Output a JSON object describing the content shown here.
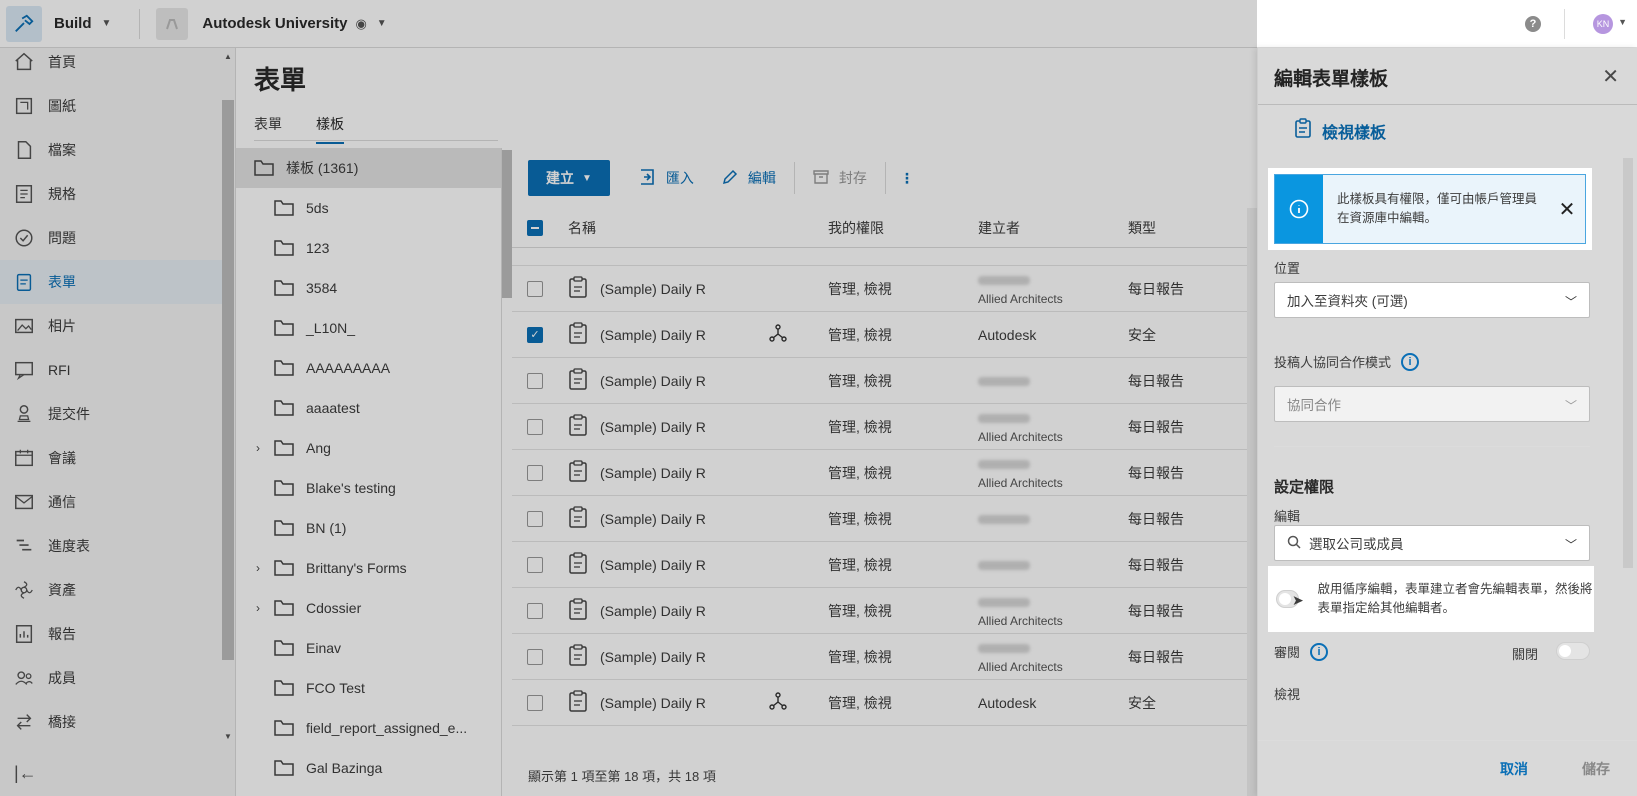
{
  "topbar": {
    "app_name": "Build",
    "project_name": "Autodesk University",
    "help_label": "?",
    "user_initials": "KN"
  },
  "sidebar": {
    "items": [
      {
        "label": "首頁",
        "icon": "home-icon"
      },
      {
        "label": "圖紙",
        "icon": "sheets-icon"
      },
      {
        "label": "檔案",
        "icon": "files-icon"
      },
      {
        "label": "規格",
        "icon": "specs-icon"
      },
      {
        "label": "問題",
        "icon": "issues-icon"
      },
      {
        "label": "表單",
        "icon": "forms-icon",
        "active": true
      },
      {
        "label": "相片",
        "icon": "photos-icon"
      },
      {
        "label": "RFI",
        "icon": "rfi-icon"
      },
      {
        "label": "提交件",
        "icon": "submittals-icon"
      },
      {
        "label": "會議",
        "icon": "meetings-icon"
      },
      {
        "label": "通信",
        "icon": "mail-icon"
      },
      {
        "label": "進度表",
        "icon": "schedule-icon"
      },
      {
        "label": "資產",
        "icon": "assets-icon"
      },
      {
        "label": "報告",
        "icon": "reports-icon"
      },
      {
        "label": "成員",
        "icon": "members-icon"
      },
      {
        "label": "橋接",
        "icon": "bridge-icon"
      }
    ]
  },
  "main": {
    "title": "表單",
    "tabs": [
      {
        "label": "表單"
      },
      {
        "label": "樣板",
        "active": true
      }
    ]
  },
  "folders": {
    "root": "樣板 (1361)",
    "items": [
      {
        "label": "5ds",
        "expandable": false
      },
      {
        "label": "123",
        "expandable": false
      },
      {
        "label": "3584",
        "expandable": false
      },
      {
        "label": "_L10N_",
        "expandable": false
      },
      {
        "label": "AAAAAAAAA",
        "expandable": false
      },
      {
        "label": "aaaatest",
        "expandable": false
      },
      {
        "label": "Ang",
        "expandable": true
      },
      {
        "label": "Blake's testing",
        "expandable": false
      },
      {
        "label": "BN (1)",
        "expandable": false
      },
      {
        "label": "Brittany's Forms",
        "expandable": true
      },
      {
        "label": "Cdossier",
        "expandable": true
      },
      {
        "label": "Einav",
        "expandable": false
      },
      {
        "label": "FCO Test",
        "expandable": false
      },
      {
        "label": "field_report_assigned_e...",
        "expandable": false
      },
      {
        "label": "Gal Bazinga",
        "expandable": false
      }
    ]
  },
  "toolbar": {
    "create": "建立",
    "import": "匯入",
    "edit": "編輯",
    "archive": "封存",
    "more": "⋮"
  },
  "table": {
    "headers": {
      "name": "名稱",
      "perm": "我的權限",
      "creator": "建立者",
      "type": "類型"
    },
    "rows": [
      {
        "name": "(Sample) Daily R",
        "shared": false,
        "perm": "管理, 檢視",
        "creator_sub": "Allied Architects",
        "type": "每日報告",
        "checked": false
      },
      {
        "name": "(Sample) Daily R",
        "shared": true,
        "perm": "管理, 檢視",
        "creator": "Autodesk",
        "type": "安全",
        "checked": true
      },
      {
        "name": "(Sample) Daily R",
        "shared": false,
        "perm": "管理, 檢視",
        "creator_sub": "",
        "type": "每日報告",
        "checked": false
      },
      {
        "name": "(Sample) Daily R",
        "shared": false,
        "perm": "管理, 檢視",
        "creator_sub": "Allied Architects",
        "type": "每日報告",
        "checked": false
      },
      {
        "name": "(Sample) Daily R",
        "shared": false,
        "perm": "管理, 檢視",
        "creator_sub": "Allied Architects",
        "type": "每日報告",
        "checked": false
      },
      {
        "name": "(Sample) Daily R",
        "shared": false,
        "perm": "管理, 檢視",
        "creator_sub": "",
        "type": "每日報告",
        "checked": false
      },
      {
        "name": "(Sample) Daily R",
        "shared": false,
        "perm": "管理, 檢視",
        "creator_sub": "",
        "type": "每日報告",
        "checked": false
      },
      {
        "name": "(Sample) Daily R",
        "shared": false,
        "perm": "管理, 檢視",
        "creator_sub": "Allied Architects",
        "type": "每日報告",
        "checked": false
      },
      {
        "name": "(Sample) Daily R",
        "shared": false,
        "perm": "管理, 檢視",
        "creator_sub": "Allied Architects",
        "type": "每日報告",
        "checked": false
      },
      {
        "name": "(Sample) Daily R",
        "shared": true,
        "perm": "管理, 檢視",
        "creator": "Autodesk",
        "type": "安全",
        "checked": false
      }
    ],
    "footer": "顯示第 1 項至第 18 項，共 18 項"
  },
  "panel": {
    "title": "編輯表單樣板",
    "view_template": "檢視樣板",
    "info_text": "此樣板具有權限，僅可由帳戶管理員在資源庫中編輯。",
    "location_label": "位置",
    "location_value": "加入至資料夾 (可選)",
    "collab_label": "投稿人協同合作模式",
    "collab_value": "協同合作",
    "perm_title": "設定權限",
    "edit_label": "編輯",
    "edit_placeholder": "選取公司或成員",
    "seq_text": "啟用循序編輯，表單建立者會先編輯表單，然後將表單指定給其他編輯者。",
    "review_label": "審閱",
    "review_toggle_label": "關閉",
    "view_label": "檢視",
    "cancel": "取消",
    "save": "儲存"
  },
  "colors": {
    "accent": "#0a6fb6",
    "info_strip": "#0a96e0"
  }
}
